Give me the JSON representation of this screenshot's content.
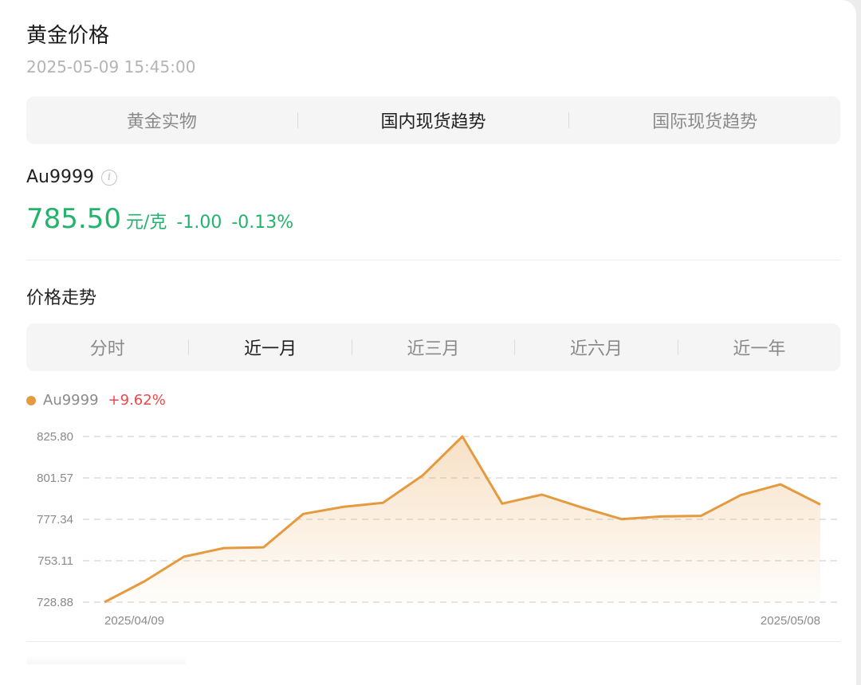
{
  "header": {
    "title": "黄金价格",
    "timestamp": "2025-05-09 15:45:00"
  },
  "tabs": [
    {
      "label": "黄金实物",
      "active": false
    },
    {
      "label": "国内现货趋势",
      "active": true
    },
    {
      "label": "国际现货趋势",
      "active": false
    }
  ],
  "quote": {
    "code": "Au9999",
    "info_icon": "info-icon",
    "price": "785.50",
    "unit": "元/克",
    "change": "-1.00",
    "change_pct": "-0.13%"
  },
  "trend": {
    "section_title": "价格走势",
    "ranges": [
      {
        "label": "分时",
        "active": false
      },
      {
        "label": "近一月",
        "active": true
      },
      {
        "label": "近三月",
        "active": false
      },
      {
        "label": "近六月",
        "active": false
      },
      {
        "label": "近一年",
        "active": false
      }
    ],
    "legend_name": "Au9999",
    "legend_return": "+9.62%"
  },
  "colors": {
    "accent": "#e59a3f",
    "up": "#f0464a",
    "down": "#23b36b"
  },
  "chart_data": {
    "type": "area",
    "series": [
      {
        "name": "Au9999",
        "values": [
          728.9,
          741.0,
          755.5,
          760.5,
          761.0,
          780.5,
          784.6,
          787.0,
          803.0,
          825.8,
          786.5,
          791.8,
          784.3,
          777.5,
          779.0,
          779.4,
          791.5,
          797.8,
          786.0
        ]
      }
    ],
    "x_start_label": "2025/04/09",
    "x_end_label": "2025/05/08",
    "y_ticks": [
      "825.80",
      "801.57",
      "777.34",
      "753.11",
      "728.88"
    ],
    "ylim": [
      728.88,
      825.8
    ],
    "grid": true,
    "legend": "top-left"
  }
}
